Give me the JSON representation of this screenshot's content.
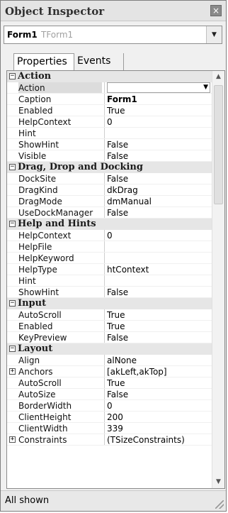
{
  "window": {
    "title": "Object Inspector",
    "close_glyph": "×"
  },
  "selector": {
    "name": "Form1",
    "class": "TForm1"
  },
  "tabs": [
    {
      "label": "Properties"
    },
    {
      "label": "Events"
    }
  ],
  "grid": {
    "rows": [
      {
        "kind": "category",
        "label": "Action",
        "collapsed": false
      },
      {
        "kind": "prop",
        "name": "Action",
        "value": "",
        "dropdown": true,
        "active": true
      },
      {
        "kind": "prop",
        "name": "Caption",
        "value": "Form1",
        "bold": true
      },
      {
        "kind": "prop",
        "name": "Enabled",
        "value": "True"
      },
      {
        "kind": "prop",
        "name": "HelpContext",
        "value": "0"
      },
      {
        "kind": "prop",
        "name": "Hint",
        "value": ""
      },
      {
        "kind": "prop",
        "name": "ShowHint",
        "value": "False"
      },
      {
        "kind": "prop",
        "name": "Visible",
        "value": "False"
      },
      {
        "kind": "category",
        "label": "Drag, Drop and Docking",
        "collapsed": false
      },
      {
        "kind": "prop",
        "name": "DockSite",
        "value": "False"
      },
      {
        "kind": "prop",
        "name": "DragKind",
        "value": "dkDrag"
      },
      {
        "kind": "prop",
        "name": "DragMode",
        "value": "dmManual"
      },
      {
        "kind": "prop",
        "name": "UseDockManager",
        "value": "False"
      },
      {
        "kind": "category",
        "label": "Help and Hints",
        "collapsed": false
      },
      {
        "kind": "prop",
        "name": "HelpContext",
        "value": "0"
      },
      {
        "kind": "prop",
        "name": "HelpFile",
        "value": ""
      },
      {
        "kind": "prop",
        "name": "HelpKeyword",
        "value": ""
      },
      {
        "kind": "prop",
        "name": "HelpType",
        "value": "htContext"
      },
      {
        "kind": "prop",
        "name": "Hint",
        "value": ""
      },
      {
        "kind": "prop",
        "name": "ShowHint",
        "value": "False"
      },
      {
        "kind": "category",
        "label": "Input",
        "collapsed": false
      },
      {
        "kind": "prop",
        "name": "AutoScroll",
        "value": "True"
      },
      {
        "kind": "prop",
        "name": "Enabled",
        "value": "True"
      },
      {
        "kind": "prop",
        "name": "KeyPreview",
        "value": "False"
      },
      {
        "kind": "category",
        "label": "Layout",
        "collapsed": false
      },
      {
        "kind": "prop",
        "name": "Align",
        "value": "alNone"
      },
      {
        "kind": "prop",
        "name": "Anchors",
        "value": "[akLeft,akTop]",
        "expandable": true
      },
      {
        "kind": "prop",
        "name": "AutoScroll",
        "value": "True"
      },
      {
        "kind": "prop",
        "name": "AutoSize",
        "value": "False"
      },
      {
        "kind": "prop",
        "name": "BorderWidth",
        "value": "0"
      },
      {
        "kind": "prop",
        "name": "ClientHeight",
        "value": "200"
      },
      {
        "kind": "prop",
        "name": "ClientWidth",
        "value": "339"
      },
      {
        "kind": "prop",
        "name": "Constraints",
        "value": "(TSizeConstraints)",
        "expandable": true
      }
    ]
  },
  "status": {
    "text": "All shown"
  },
  "glyphs": {
    "minus": "−",
    "plus": "+",
    "pointer": "»",
    "dropdown": "▼",
    "scroll_up": "▲",
    "scroll_down": "▼"
  }
}
